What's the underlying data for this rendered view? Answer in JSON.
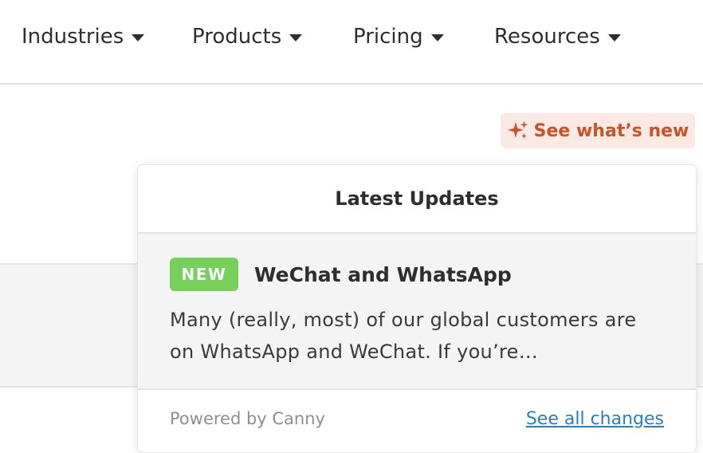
{
  "nav": {
    "items": [
      {
        "label": "Industries"
      },
      {
        "label": "Products"
      },
      {
        "label": "Pricing"
      },
      {
        "label": "Resources"
      }
    ]
  },
  "whats_new": {
    "label": "See what’s new",
    "icon": "sparkle-icon",
    "color": "#c8532a",
    "background": "#fbeae3"
  },
  "updates_popover": {
    "title": "Latest Updates",
    "item": {
      "badge": "NEW",
      "badge_color": "#77d05a",
      "title": "WeChat and WhatsApp",
      "excerpt": "Many (really, most) of our global customers are on WhatsApp and WeChat. If you’re…"
    },
    "footer": {
      "powered_by": "Powered by Canny",
      "see_all_label": "See all changes",
      "link_color": "#2b7fb8"
    }
  }
}
